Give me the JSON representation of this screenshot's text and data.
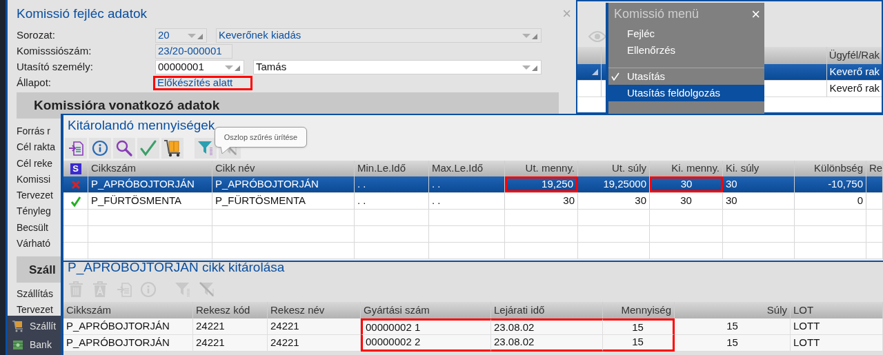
{
  "header_window": {
    "title": "Komissió fejléc adatok",
    "close": "×",
    "fields": [
      {
        "label": "Sorozat:",
        "controls": [
          {
            "kind": "combo",
            "value": "20",
            "disabled": true,
            "highlighted": false
          },
          {
            "kind": "combo",
            "value": "Keverőnek kiadás",
            "disabled": true,
            "highlighted": false
          }
        ]
      },
      {
        "label": "Komisssiószám:",
        "controls": [
          {
            "kind": "text",
            "value": "23/20-000001",
            "disabled": true,
            "highlighted": false
          }
        ]
      },
      {
        "label": "Utasító személy:",
        "controls": [
          {
            "kind": "combo",
            "value": "00000001",
            "disabled": false,
            "highlighted": false
          },
          {
            "kind": "combo",
            "value": "Tamás",
            "disabled": false,
            "highlighted": false
          }
        ]
      },
      {
        "label": "Állapot:",
        "controls": [
          {
            "kind": "text",
            "value": "Előkészítés alatt",
            "disabled": true,
            "highlighted": true
          }
        ]
      }
    ],
    "section_title": "Komissióra vonatkozó adatok",
    "section_labels": [
      "Forrás r",
      "Cél rakta",
      "Cél reke",
      "Komissi",
      "Tervezet",
      "Tényleg",
      "Becsült",
      "Várható"
    ],
    "section2_title": "Száll",
    "section2_labels": [
      "Szállítás",
      "Tervezet"
    ],
    "sidebar": [
      {
        "label": "Szállít"
      },
      {
        "label": "Bank"
      }
    ]
  },
  "list_window": {
    "columns": [
      "Ügyfél/Rak"
    ],
    "rows": [
      {
        "cells": [
          "Keverő rak"
        ],
        "selected": true
      },
      {
        "cells": [
          "Keverő rak"
        ],
        "selected": false
      }
    ]
  },
  "menu": {
    "title": "Komissió menü",
    "close": "×",
    "items": [
      {
        "kind": "item",
        "label": "Fejléc",
        "checked": false,
        "selected": false
      },
      {
        "kind": "item",
        "label": "Ellenőrzés",
        "checked": false,
        "selected": false
      },
      {
        "kind": "separator"
      },
      {
        "kind": "item",
        "label": "Utasítás",
        "checked": true,
        "selected": false
      },
      {
        "kind": "item",
        "label": "Utasítás feldolgozás",
        "checked": false,
        "selected": true
      }
    ]
  },
  "quantities_window": {
    "title": "Kitárolandó mennyiségek",
    "tooltip": "Oszlop szűrés ürítése",
    "status_header": "S",
    "columns": [
      "Cikkszám",
      "Cikk név",
      "Min.Le.Idő",
      "Max.Le.Idő",
      "Ut. menny.",
      "Ut. súly",
      "Ki. menny.",
      "Ki. súly",
      "Különbség",
      "Re"
    ],
    "rows": [
      {
        "error": true,
        "selected": true,
        "cells": [
          {
            "text": "P_APRÓBOJTORJÁN",
            "highlighted": false
          },
          {
            "text": "P_APRÓBOJTORJÁN",
            "highlighted": false
          },
          {
            "text": ". .",
            "highlighted": false
          },
          {
            "text": ". .",
            "highlighted": false
          },
          {
            "text": "19,250",
            "highlighted": true
          },
          {
            "text": "19,25000",
            "highlighted": false
          },
          {
            "text": "30",
            "highlighted": true
          },
          {
            "text": "30",
            "highlighted": false
          },
          {
            "text": "-10,750",
            "highlighted": false
          }
        ]
      },
      {
        "error": false,
        "selected": false,
        "cells": [
          {
            "text": "P_FÜRTÖSMENTA",
            "highlighted": false
          },
          {
            "text": "P_FÜRTÖSMENTA",
            "highlighted": false
          },
          {
            "text": ". .",
            "highlighted": false
          },
          {
            "text": ". .",
            "highlighted": false
          },
          {
            "text": "30",
            "highlighted": false
          },
          {
            "text": "30",
            "highlighted": false
          },
          {
            "text": "30",
            "highlighted": false
          },
          {
            "text": "30",
            "highlighted": false
          },
          {
            "text": "0",
            "highlighted": false
          }
        ]
      }
    ]
  },
  "storage_window": {
    "title": "P_APROBOJTORJAN cikk kitárolása",
    "columns": [
      "Cikkszám",
      "Rekesz kód",
      "Rekesz név",
      "Gyártási szám",
      "Lejárati idő",
      "Mennyiség",
      "Súly",
      "LOT"
    ],
    "rows": [
      {
        "cells": [
          {
            "text": "P_APRÓBOJTORJÁN",
            "highlighted": false
          },
          {
            "text": "24221",
            "highlighted": false
          },
          {
            "text": "24221",
            "highlighted": false
          },
          {
            "text": "00000002 1",
            "highlighted": true
          },
          {
            "text": "23.08.02",
            "highlighted": true
          },
          {
            "text": "15",
            "highlighted": true
          },
          {
            "text": "15",
            "highlighted": false
          },
          {
            "text": "LOTT",
            "highlighted": false
          }
        ]
      },
      {
        "cells": [
          {
            "text": "P_APRÓBOJTORJÁN",
            "highlighted": false
          },
          {
            "text": "24221",
            "highlighted": false
          },
          {
            "text": "24221",
            "highlighted": false
          },
          {
            "text": "00000002 2",
            "highlighted": true
          },
          {
            "text": "23.08.02",
            "highlighted": true
          },
          {
            "text": "15",
            "highlighted": true
          },
          {
            "text": "15",
            "highlighted": false
          },
          {
            "text": "LOTT",
            "highlighted": false
          }
        ]
      }
    ]
  }
}
